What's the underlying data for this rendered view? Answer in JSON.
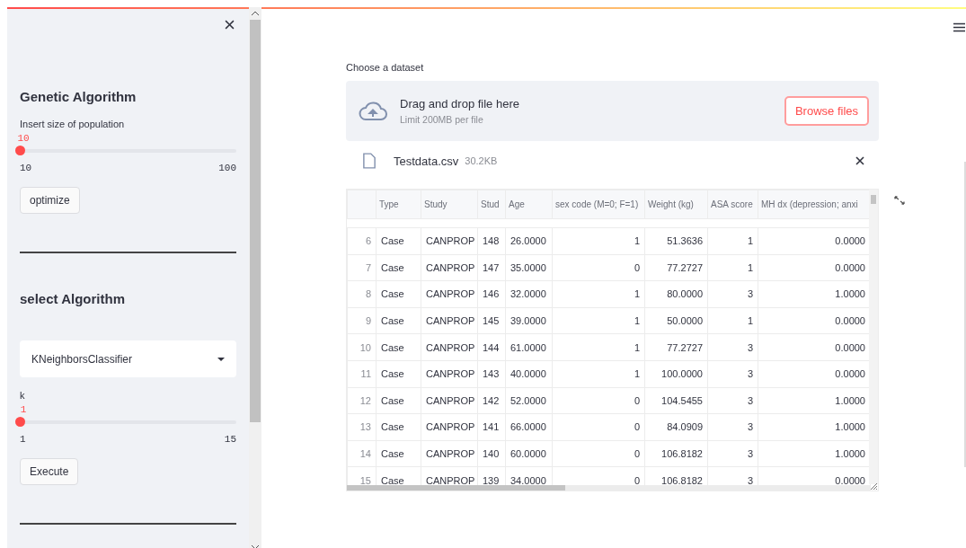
{
  "sidebar": {
    "sections": [
      {
        "kind": "slider",
        "heading": "Genetic Algorithm",
        "label": "Insert size of population",
        "value": "10",
        "min": "10",
        "max": "100",
        "level": 0,
        "button": "optimize"
      },
      {
        "kind": "select",
        "heading": "select Algorithm",
        "selected_option": "KNeighborsClassifier",
        "slider": {
          "label": "k",
          "value": "1",
          "min": "1",
          "max": "15",
          "level": 0
        },
        "button": "Execute"
      }
    ]
  },
  "main": {
    "uploader": {
      "label": "Choose a dataset",
      "instruction": "Drag and drop file here",
      "limit": "Limit 200MB per file",
      "button": "Browse files",
      "file": {
        "name": "Testdata.csv",
        "size": "30.2KB"
      }
    },
    "table": {
      "columns": [
        "Type",
        "Study",
        "Stud",
        "Age",
        "sex code (M=0; F=1)",
        "Weight (kg)",
        "ASA score",
        "MH dx (depression; anxi"
      ],
      "rows": [
        {
          "index": "6",
          "cells": [
            "Case",
            "CANPROP",
            "148",
            "26.0000",
            "1",
            "51.3636",
            "1",
            "0.0000"
          ]
        },
        {
          "index": "7",
          "cells": [
            "Case",
            "CANPROP",
            "147",
            "35.0000",
            "0",
            "77.2727",
            "1",
            "0.0000"
          ]
        },
        {
          "index": "8",
          "cells": [
            "Case",
            "CANPROP",
            "146",
            "32.0000",
            "1",
            "80.0000",
            "3",
            "1.0000"
          ]
        },
        {
          "index": "9",
          "cells": [
            "Case",
            "CANPROP",
            "145",
            "39.0000",
            "1",
            "50.0000",
            "1",
            "0.0000"
          ]
        },
        {
          "index": "10",
          "cells": [
            "Case",
            "CANPROP",
            "144",
            "61.0000",
            "1",
            "77.2727",
            "3",
            "0.0000"
          ]
        },
        {
          "index": "11",
          "cells": [
            "Case",
            "CANPROP",
            "143",
            "40.0000",
            "1",
            "100.0000",
            "3",
            "0.0000"
          ]
        },
        {
          "index": "12",
          "cells": [
            "Case",
            "CANPROP",
            "142",
            "52.0000",
            "0",
            "104.5455",
            "3",
            "1.0000"
          ]
        },
        {
          "index": "13",
          "cells": [
            "Case",
            "CANPROP",
            "141",
            "66.0000",
            "0",
            "84.0909",
            "3",
            "1.0000"
          ]
        },
        {
          "index": "14",
          "cells": [
            "Case",
            "CANPROP",
            "140",
            "60.0000",
            "0",
            "106.8182",
            "3",
            "1.0000"
          ]
        },
        {
          "index": "15",
          "cells": [
            "Case",
            "CANPROP",
            "139",
            "34.0000",
            "0",
            "106.8182",
            "3",
            "0.0000"
          ]
        }
      ]
    }
  }
}
